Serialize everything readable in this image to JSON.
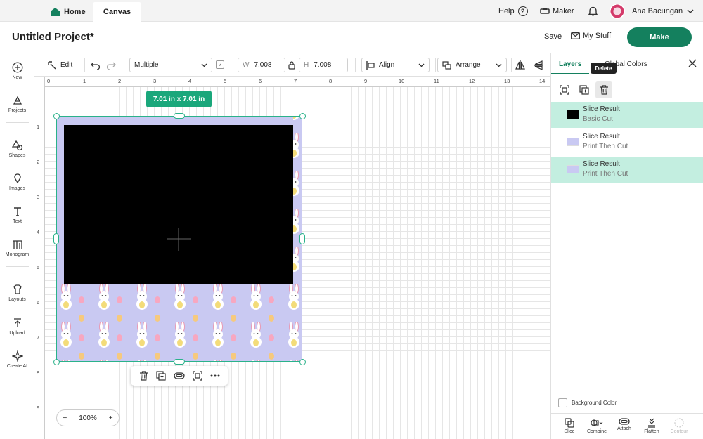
{
  "topbar": {
    "home": "Home",
    "canvas": "Canvas",
    "help": "Help",
    "help_icon": "?",
    "maker": "Maker",
    "user": "Ana Bacungan"
  },
  "header": {
    "title": "Untitled Project*",
    "save": "Save",
    "mystuff": "My Stuff",
    "make": "Make"
  },
  "sidebar": {
    "items": [
      {
        "label": "New",
        "icon": "plus-circle-icon"
      },
      {
        "label": "Projects",
        "icon": "projects-icon"
      },
      {
        "label": "Shapes",
        "icon": "shapes-icon"
      },
      {
        "label": "Images",
        "icon": "images-icon"
      },
      {
        "label": "Text",
        "icon": "text-icon"
      },
      {
        "label": "Monogram",
        "icon": "monogram-icon"
      },
      {
        "label": "Layouts",
        "icon": "layouts-icon"
      },
      {
        "label": "Upload",
        "icon": "upload-icon"
      },
      {
        "label": "Create AI",
        "icon": "sparkle-icon"
      }
    ]
  },
  "toolbar": {
    "edit": "Edit",
    "operation": "Multiple",
    "help_badge": "?",
    "w_label": "W",
    "w_value": "7.008",
    "h_label": "H",
    "h_value": "7.008",
    "align": "Align",
    "arrange": "Arrange"
  },
  "ruler": {
    "top": [
      "0",
      "1",
      "2",
      "3",
      "4",
      "5",
      "6",
      "7",
      "8",
      "9",
      "10",
      "11",
      "12",
      "13",
      "14"
    ],
    "left": [
      "1",
      "2",
      "3",
      "4",
      "5",
      "6",
      "7",
      "8",
      "9"
    ]
  },
  "canvas": {
    "size_badge": "7.01  in x 7.01  in",
    "zoom": "100%",
    "zoom_minus": "−",
    "zoom_plus": "+"
  },
  "panel": {
    "tab_layers": "Layers",
    "tab_colors": "Global Colors",
    "tooltip": "Delete",
    "layers": [
      {
        "name": "Slice Result",
        "type": "Basic Cut",
        "swatch": "#000000",
        "selected": true
      },
      {
        "name": "Slice Result",
        "type": "Print Then Cut",
        "swatch": "#c9c9f2",
        "selected": false
      },
      {
        "name": "Slice Result",
        "type": "Print Then Cut",
        "swatch": "#c9c9f2",
        "selected": true
      }
    ],
    "background_color": "Background Color",
    "bottom_tools": [
      "Slice",
      "Combine",
      "Attach",
      "Flatten",
      "Contour"
    ]
  },
  "colors": {
    "accent": "#14805e",
    "selected_row": "#c3eee0",
    "artwork_bg": "#c9c9f2"
  }
}
